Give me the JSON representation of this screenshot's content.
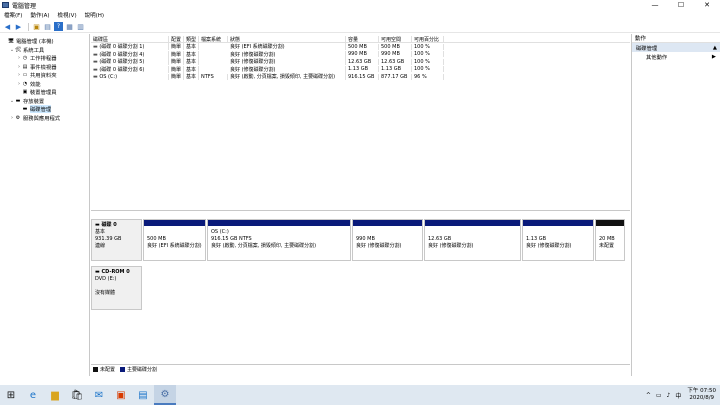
{
  "window": {
    "title": "電腦管理",
    "controls": [
      "—",
      "☐",
      "✕"
    ]
  },
  "menu": [
    "檔案(F)",
    "動作(A)",
    "檢視(V)",
    "說明(H)"
  ],
  "toolbar": [
    "◀",
    "▶",
    "▣",
    "▤",
    "?",
    "▦",
    "▥"
  ],
  "tree": [
    {
      "indent": 0,
      "exp": "",
      "icon": "computer-icon",
      "glyph": "🖥",
      "label": "電腦管理 (本機)"
    },
    {
      "indent": 1,
      "exp": "⌄",
      "icon": "tools-icon",
      "glyph": "🛠",
      "label": "系統工具"
    },
    {
      "indent": 2,
      "exp": "›",
      "icon": "clock-icon",
      "glyph": "◷",
      "label": "工作排程器"
    },
    {
      "indent": 2,
      "exp": "›",
      "icon": "event-icon",
      "glyph": "▤",
      "label": "事件檢視器"
    },
    {
      "indent": 2,
      "exp": "›",
      "icon": "folder-icon",
      "glyph": "▭",
      "label": "共用資料夾"
    },
    {
      "indent": 2,
      "exp": "›",
      "icon": "performance-icon",
      "glyph": "◔",
      "label": "效能"
    },
    {
      "indent": 2,
      "exp": "",
      "icon": "device-icon",
      "glyph": "▣",
      "label": "裝置管理員"
    },
    {
      "indent": 1,
      "exp": "⌄",
      "icon": "storage-icon",
      "glyph": "▬",
      "label": "存放裝置"
    },
    {
      "indent": 2,
      "exp": "",
      "icon": "disk-icon",
      "glyph": "▬",
      "label": "磁碟管理",
      "selected": true
    },
    {
      "indent": 1,
      "exp": "›",
      "icon": "services-icon",
      "glyph": "⚙",
      "label": "服務與應用程式"
    }
  ],
  "volumes": {
    "headers": [
      "磁碟區",
      "配置",
      "類型",
      "檔案系統",
      "狀態",
      "容量",
      "可用空間",
      "可用百分比"
    ],
    "rows": [
      [
        "(磁碟 0 磁碟分割 1)",
        "簡單",
        "基本",
        "",
        "良好 (EFI 系統磁碟分割)",
        "500 MB",
        "500 MB",
        "100 %"
      ],
      [
        "(磁碟 0 磁碟分割 4)",
        "簡單",
        "基本",
        "",
        "良好 (修復磁碟分割)",
        "990 MB",
        "990 MB",
        "100 %"
      ],
      [
        "(磁碟 0 磁碟分割 5)",
        "簡單",
        "基本",
        "",
        "良好 (修復磁碟分割)",
        "12.63 GB",
        "12.63 GB",
        "100 %"
      ],
      [
        "(磁碟 0 磁碟分割 6)",
        "簡單",
        "基本",
        "",
        "良好 (修復磁碟分割)",
        "1.13 GB",
        "1.13 GB",
        "100 %"
      ],
      [
        "OS (C:)",
        "簡單",
        "基本",
        "NTFS",
        "良好 (啟動, 分頁檔案, 損毀傾印, 主要磁碟分割)",
        "916.15 GB",
        "877.17 GB",
        "96 %"
      ]
    ]
  },
  "disks": [
    {
      "name": "磁碟 0",
      "lines": [
        "基本",
        "931.39 GB",
        "連線"
      ],
      "partitions": [
        {
          "title": "",
          "size": "500 MB",
          "status": "良好 (EFI 系統磁碟分割)",
          "unalloc": false
        },
        {
          "title": "OS (C:)",
          "size": "916.15 GB NTFS",
          "status": "良好 (啟動, 分頁檔案, 損毀傾印, 主要磁碟分割)",
          "unalloc": false
        },
        {
          "title": "",
          "size": "990 MB",
          "status": "良好 (修復磁碟分割)",
          "unalloc": false
        },
        {
          "title": "",
          "size": "12.63 GB",
          "status": "良好 (修復磁碟分割)",
          "unalloc": false
        },
        {
          "title": "",
          "size": "1.13 GB",
          "status": "良好 (修復磁碟分割)",
          "unalloc": false
        },
        {
          "title": "",
          "size": "20 MB",
          "status": "未配置",
          "unalloc": true
        }
      ]
    },
    {
      "name": "CD-ROM 0",
      "lines": [
        "DVD (E:)",
        "",
        "沒有媒體"
      ],
      "partitions": []
    }
  ],
  "legend": [
    {
      "label": "未配置",
      "color": "#111111"
    },
    {
      "label": "主要磁碟分割",
      "color": "#0a1a7a"
    }
  ],
  "actions": {
    "header": "動作",
    "section": "磁碟管理",
    "section_arrow": "▲",
    "item": "其他動作",
    "item_arrow": "▶"
  },
  "taskbar": {
    "icons": [
      {
        "name": "start-icon",
        "glyph": "⊞"
      },
      {
        "name": "edge-icon",
        "glyph": "e"
      },
      {
        "name": "file-explorer-icon",
        "glyph": "▆"
      },
      {
        "name": "store-icon",
        "glyph": "🛍"
      },
      {
        "name": "mail-icon",
        "glyph": "✉"
      },
      {
        "name": "office-icon",
        "glyph": "▣"
      },
      {
        "name": "control-panel-icon",
        "glyph": "▤"
      },
      {
        "name": "computer-management-icon",
        "glyph": "⚙",
        "active": true
      }
    ],
    "tray": [
      "^",
      "▭",
      "♪",
      "中"
    ],
    "time": "下午 07:50",
    "date": "2020/8/9"
  }
}
